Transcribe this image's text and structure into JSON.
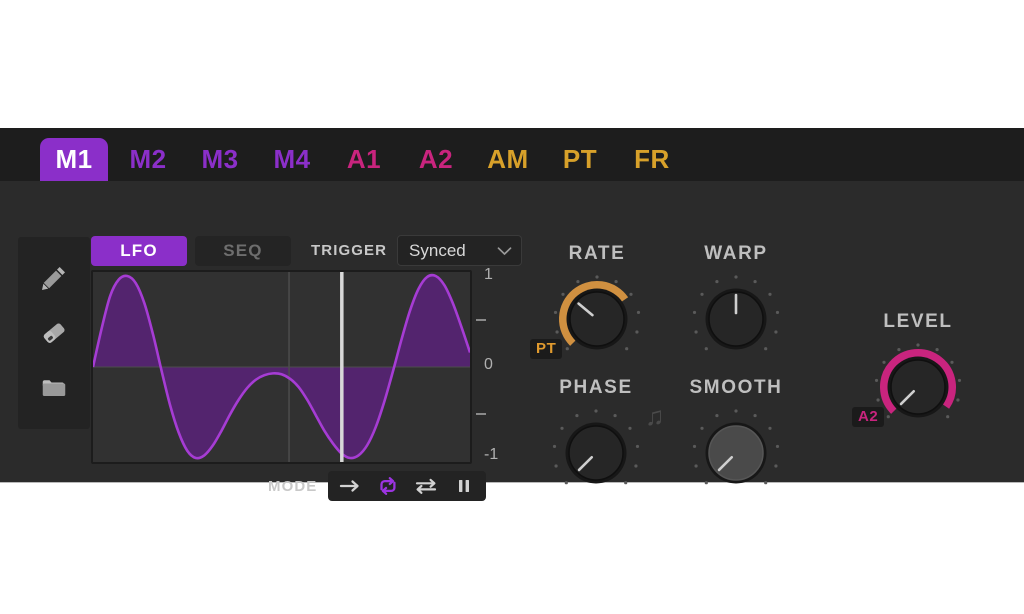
{
  "window": {
    "background": "#ffffff",
    "panel_bg": "#2b2b2b",
    "tabbar_bg": "#1d1d1d"
  },
  "tabs": [
    {
      "label": "M1",
      "color": "#ffffff",
      "active": true,
      "accent": "#8b2fc9"
    },
    {
      "label": "M2",
      "color": "#8b2fc9",
      "active": false,
      "accent": "#8b2fc9"
    },
    {
      "label": "M3",
      "color": "#8b2fc9",
      "active": false,
      "accent": "#8b2fc9"
    },
    {
      "label": "M4",
      "color": "#8b2fc9",
      "active": false,
      "accent": "#8b2fc9"
    },
    {
      "label": "A1",
      "color": "#c9247e",
      "active": false,
      "accent": "#c9247e"
    },
    {
      "label": "A2",
      "color": "#c9247e",
      "active": false,
      "accent": "#c9247e"
    },
    {
      "label": "AM",
      "color": "#d8a12a",
      "active": false,
      "accent": "#d8a12a"
    },
    {
      "label": "PT",
      "color": "#d8a12a",
      "active": false,
      "accent": "#d8a12a"
    },
    {
      "label": "FR",
      "color": "#d8a12a",
      "active": false,
      "accent": "#d8a12a"
    }
  ],
  "tools": [
    {
      "name": "pencil-tool",
      "icon": "pencil-icon",
      "selected": false
    },
    {
      "name": "eraser-tool",
      "icon": "eraser-icon",
      "selected": false
    },
    {
      "name": "folder-tool",
      "icon": "folder-icon",
      "selected": false
    }
  ],
  "source_toggle": {
    "lfo_label": "LFO",
    "seq_label": "SEQ",
    "active": "LFO"
  },
  "trigger": {
    "label": "TRIGGER",
    "value": "Synced",
    "chevron": "chevron-down-icon",
    "options": [
      "Synced"
    ]
  },
  "waveform": {
    "curve_color": "#a63cd4",
    "fill_color": "#53246e",
    "grid_color": "#4d4d4d",
    "playhead_color": "#d8d8d8",
    "playhead_position_pct": 66,
    "center_grid_pct": 52,
    "axis_labels": [
      "1",
      "0",
      "-1"
    ],
    "axis_values": [
      1,
      0,
      -1
    ],
    "points": [
      0.0,
      0.42,
      0.78,
      0.96,
      1.0,
      0.92,
      0.7,
      0.36,
      -0.04,
      -0.42,
      -0.72,
      -0.92,
      -1.0,
      -0.97,
      -0.86,
      -0.7,
      -0.52,
      -0.36,
      -0.23,
      -0.14,
      -0.09,
      -0.07,
      -0.08,
      -0.13,
      -0.22,
      -0.36,
      -0.53,
      -0.7,
      -0.84,
      -0.95,
      -1.0,
      -0.97,
      -0.86,
      -0.66,
      -0.38,
      -0.05,
      0.3,
      0.62,
      0.86,
      0.99,
      1.0,
      0.9,
      0.7,
      0.44,
      0.16
    ]
  },
  "mode": {
    "label": "MODE",
    "buttons": [
      {
        "name": "mode-forward",
        "icon": "arrow-right-icon",
        "active": false
      },
      {
        "name": "mode-loop",
        "icon": "loop-repeat-icon",
        "active": true
      },
      {
        "name": "mode-pingpong",
        "icon": "two-way-arrows-icon",
        "active": false
      },
      {
        "name": "mode-pause",
        "icon": "pause-icon",
        "active": false
      }
    ],
    "active_color": "#9b34e0",
    "inactive_color": "#d2d2d2"
  },
  "knobs": [
    {
      "name": "rate-knob",
      "label": "RATE",
      "arc_color": "#d09040",
      "arc_start_deg": -135,
      "arc_end_deg": 55,
      "pointer_deg": -50,
      "has_arc": true,
      "highlight": false,
      "badge": {
        "text": "PT",
        "color": "#e09a2e"
      }
    },
    {
      "name": "warp-knob",
      "label": "WARP",
      "arc_color": "#d09040",
      "arc_start_deg": 0,
      "arc_end_deg": 0,
      "pointer_deg": 0,
      "has_arc": false,
      "highlight": false,
      "badge": null
    },
    {
      "name": "phase-knob",
      "label": "PHASE",
      "arc_color": "#d09040",
      "arc_start_deg": 0,
      "arc_end_deg": 0,
      "pointer_deg": -135,
      "has_arc": false,
      "highlight": false,
      "badge": null
    },
    {
      "name": "smooth-knob",
      "label": "SMOOTH",
      "arc_color": "#d09040",
      "arc_start_deg": 0,
      "arc_end_deg": 0,
      "pointer_deg": -135,
      "has_arc": false,
      "highlight": true,
      "badge": null
    },
    {
      "name": "level-knob",
      "label": "LEVEL",
      "arc_color": "#c9247e",
      "arc_start_deg": -135,
      "arc_end_deg": 125,
      "pointer_deg": -135,
      "has_arc": true,
      "highlight": false,
      "badge": {
        "text": "A2",
        "color": "#c9247e"
      }
    }
  ],
  "note_icon": {
    "name": "music-note-icon",
    "glyph": "♫"
  }
}
